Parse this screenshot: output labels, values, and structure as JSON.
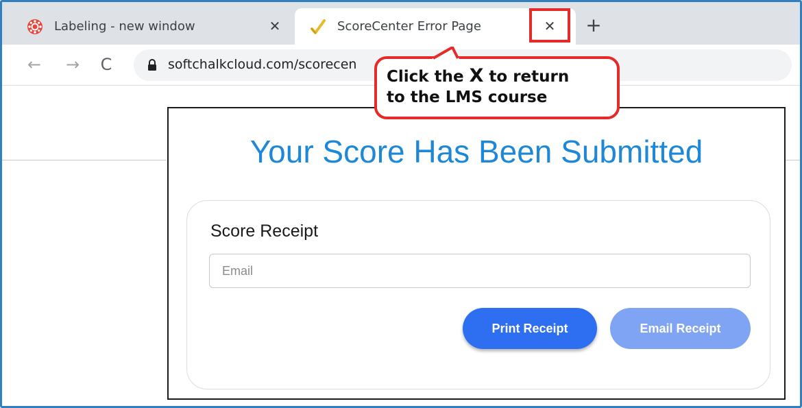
{
  "browser": {
    "tabs": [
      {
        "title": "Labeling - new window",
        "icon": "canvas-lms-icon",
        "active": false,
        "close_glyph": "✕"
      },
      {
        "title": "ScoreCenter Error Page",
        "icon": "scorecenter-check-icon",
        "active": true,
        "close_glyph": "✕"
      }
    ],
    "new_tab_glyph": "+",
    "nav": {
      "back_glyph": "←",
      "forward_glyph": "→",
      "reload_glyph": "C"
    },
    "url": "softchalkcloud.com/scorecen"
  },
  "popup": {
    "title": "Your Score Has Been Submitted",
    "receipt": {
      "heading": "Score Receipt",
      "email_placeholder": "Email",
      "print_button": "Print Receipt",
      "email_button": "Email Receipt"
    }
  },
  "callout": {
    "line1_prefix": "Click the ",
    "line1_x": "X",
    "line1_suffix": " to return",
    "line2": "to the LMS course"
  },
  "colors": {
    "frame": "#2f7fc1",
    "highlight": "#e52a2a",
    "title": "#1e88d7",
    "print_button": "#2d6ff0",
    "email_button": "#7ea4f3"
  }
}
